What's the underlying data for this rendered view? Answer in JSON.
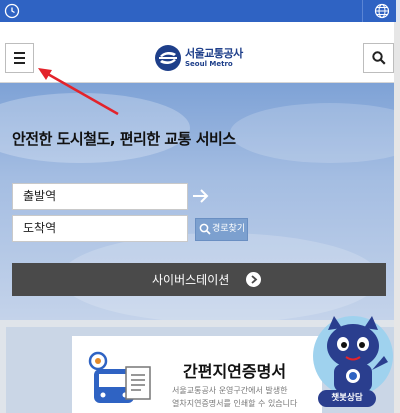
{
  "topbar": {
    "clock_icon": "clock-icon",
    "globe_icon": "globe-icon"
  },
  "header": {
    "menu_icon": "hamburger-menu-icon",
    "search_icon": "search-icon",
    "logo_name": "서울교통공사",
    "logo_sub": "Seoul Metro"
  },
  "hero": {
    "tagline": "안전한 도시철도, 편리한 교통 서비스",
    "departure_value": "출발역",
    "arrival_value": "도착역",
    "route_button": "경로찾기",
    "cyber_station": "사이버스테이션"
  },
  "cert": {
    "title": "간편지연증명서",
    "desc_line1": "서울교통공사 운영구간에서 발생한",
    "desc_line2": "열차지연증명서를 인쇄할 수 있습니다"
  },
  "chatbot": {
    "label": "챗봇상담"
  },
  "colors": {
    "topbar": "#2f63c3",
    "brand": "#1e3f8a",
    "button_dark": "#4a4a4a",
    "annotation": "#e3232b"
  }
}
